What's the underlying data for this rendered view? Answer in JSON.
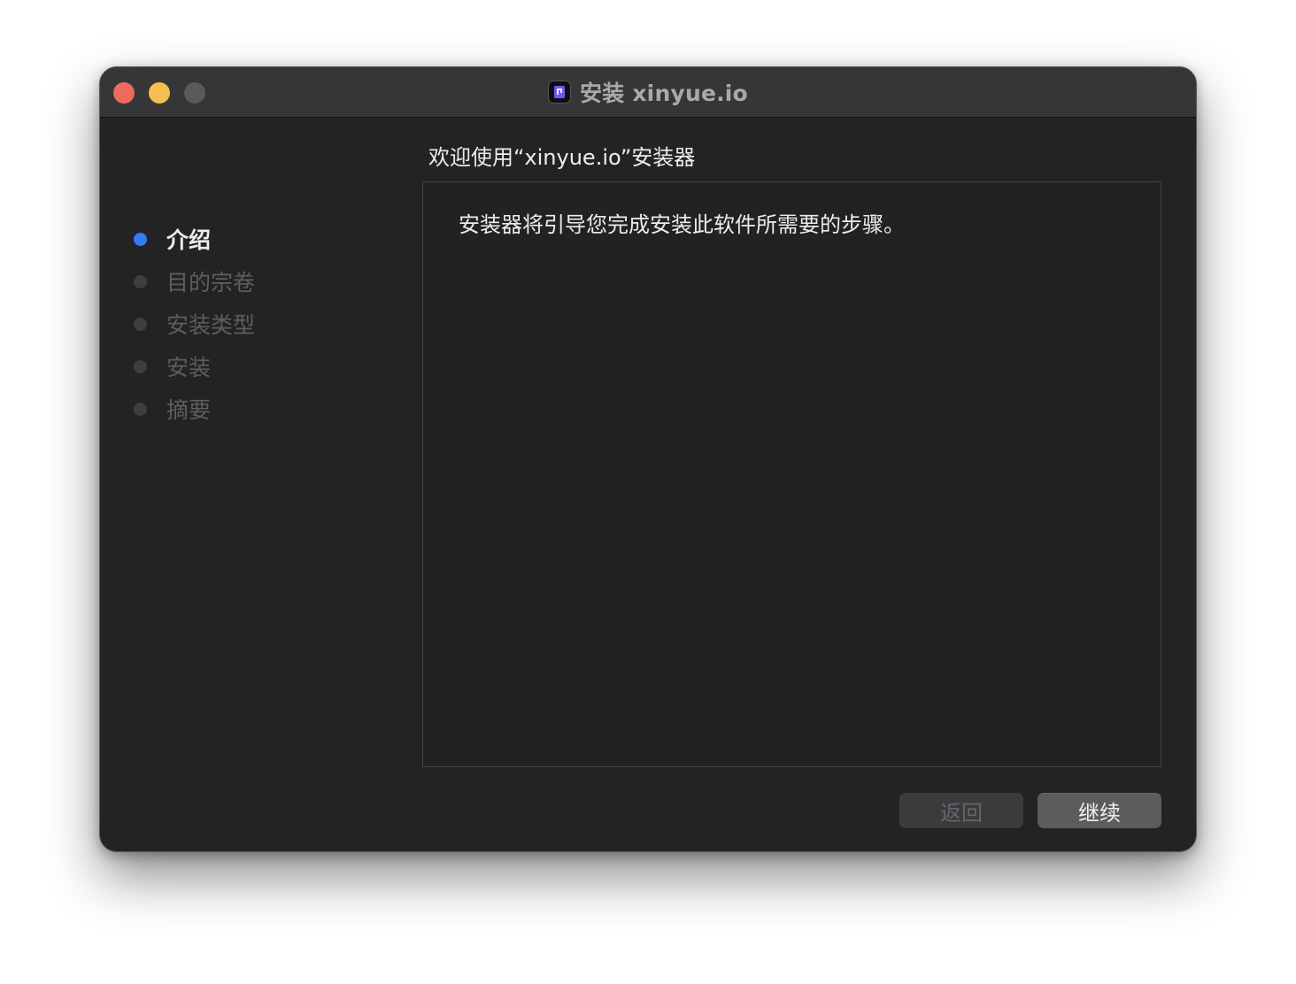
{
  "window": {
    "title": "安装 xinyue.io",
    "app_icon": "installer-package-icon"
  },
  "traffic_lights": {
    "close": "#ed6a5e",
    "minimize": "#f5bf4f",
    "zoom": "#5a5a5c"
  },
  "sidebar": {
    "steps": [
      {
        "label": "介绍",
        "active": true
      },
      {
        "label": "目的宗卷",
        "active": false
      },
      {
        "label": "安装类型",
        "active": false
      },
      {
        "label": "安装",
        "active": false
      },
      {
        "label": "摘要",
        "active": false
      }
    ]
  },
  "main": {
    "heading": "欢迎使用“xinyue.io”安装器",
    "body_text": "安装器将引导您完成安装此软件所需要的步骤。"
  },
  "buttons": {
    "back_label": "返回",
    "continue_label": "继续"
  },
  "colors": {
    "accent": "#2f7cf6",
    "window_bg": "#232325",
    "titlebar_bg": "#363638"
  }
}
